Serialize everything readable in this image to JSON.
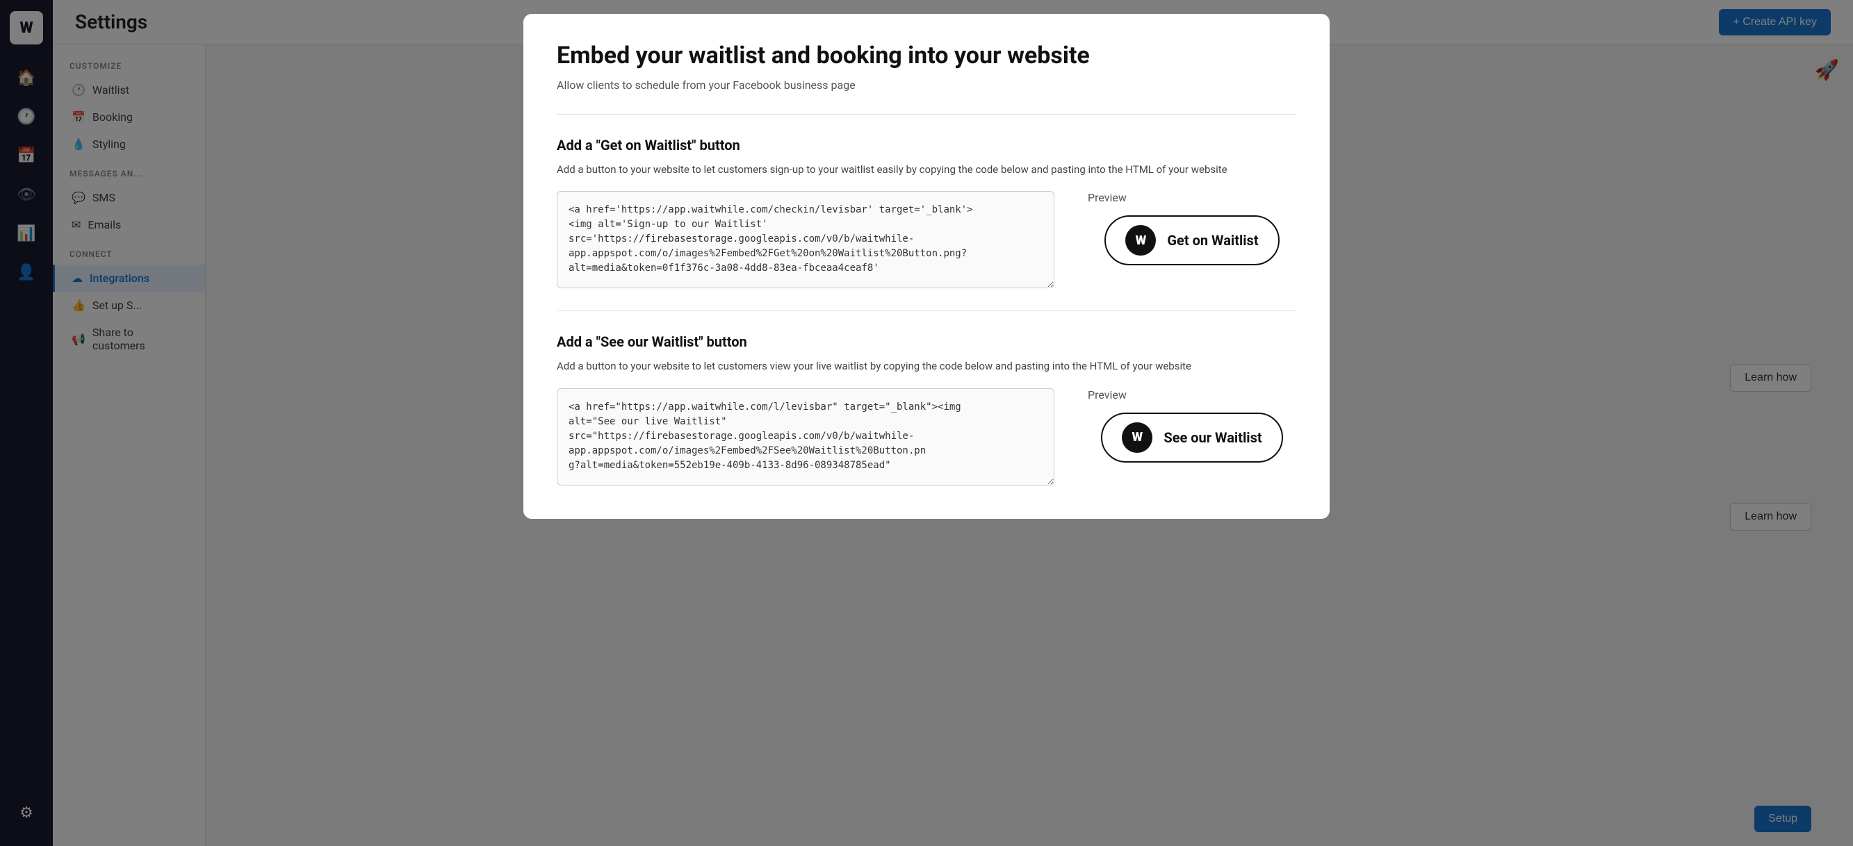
{
  "sidebar": {
    "logo": "W",
    "icons": [
      {
        "name": "home-icon",
        "symbol": "🏠",
        "active": false
      },
      {
        "name": "clock-icon",
        "symbol": "🕐",
        "active": false
      },
      {
        "name": "calendar-icon",
        "symbol": "📅",
        "active": false
      },
      {
        "name": "eye-icon",
        "symbol": "👁",
        "active": false
      },
      {
        "name": "chart-icon",
        "symbol": "📊",
        "active": false
      },
      {
        "name": "user-icon",
        "symbol": "👤",
        "active": false
      },
      {
        "name": "settings-icon",
        "symbol": "⚙",
        "active": true
      }
    ]
  },
  "topbar": {
    "title": "Settings",
    "create_api_label": "+ Create API key"
  },
  "left_nav": {
    "customize_label": "CUSTOMIZE",
    "messages_label": "MESSAGES AN...",
    "connect_label": "CONNECT",
    "items": [
      {
        "label": "Waitlist",
        "icon": "🕐",
        "active": false,
        "section": "customize"
      },
      {
        "label": "Booking",
        "icon": "📅",
        "active": false,
        "section": "customize"
      },
      {
        "label": "Styling",
        "icon": "💧",
        "active": false,
        "section": "customize"
      },
      {
        "label": "SMS",
        "icon": "💬",
        "active": false,
        "section": "messages"
      },
      {
        "label": "Emails",
        "icon": "✉",
        "active": false,
        "section": "messages"
      },
      {
        "label": "Integrations",
        "icon": "☁",
        "active": true,
        "section": "connect"
      },
      {
        "label": "Set up S...",
        "icon": "👍",
        "active": false,
        "section": "connect"
      },
      {
        "label": "Share to customers",
        "icon": "📢",
        "active": false,
        "section": "connect"
      }
    ]
  },
  "background": {
    "learn_how_1": "Learn how",
    "learn_how_2": "Learn how",
    "setup": "Setup"
  },
  "modal": {
    "title": "Embed your waitlist and booking into your website",
    "subtitle": "Allow clients to schedule from your Facebook business page",
    "section1": {
      "title": "Add a \"Get on Waitlist\" button",
      "description": "Add a button to your website to let customers sign-up to your waitlist easily by copying the code below and pasting into the HTML of your website",
      "code": "<a href='https://app.waitwhile.com/checkin/levisbar' target='_blank'>\n<img alt='Sign-up to our Waitlist'\nsrc='https://firebasestorage.googleapis.com/v0/b/waitwhile-app.appspot.com/o/images%2Fembed%2FGet%20on%20Waitlist%20Button.png?alt=media&token=0f1f376c-3a08-4dd8-83ea-fbceaa4ceaf8'",
      "preview_label": "Preview",
      "btn_text": "Get on Waitlist"
    },
    "section2": {
      "title": "Add a \"See our Waitlist\" button",
      "description": "Add a button to your website to let customers view your live waitlist by copying the code below and pasting into the HTML of your website",
      "code": "<a href=\"https://app.waitwhile.com/l/levisbar\" target=\"_blank\"><img\nalt=\"See our live Waitlist\"\nsrc=\"https://firebasestorage.googleapis.com/v0/b/waitwhile-app.appspot.com/o/images%2Fembed%2FSee%20Waitlist%20Button.pn\ng?alt=media&token=552eb19e-409b-4133-8d96-089348785ead\"",
      "preview_label": "Preview",
      "btn_text": "See our Waitlist"
    }
  }
}
